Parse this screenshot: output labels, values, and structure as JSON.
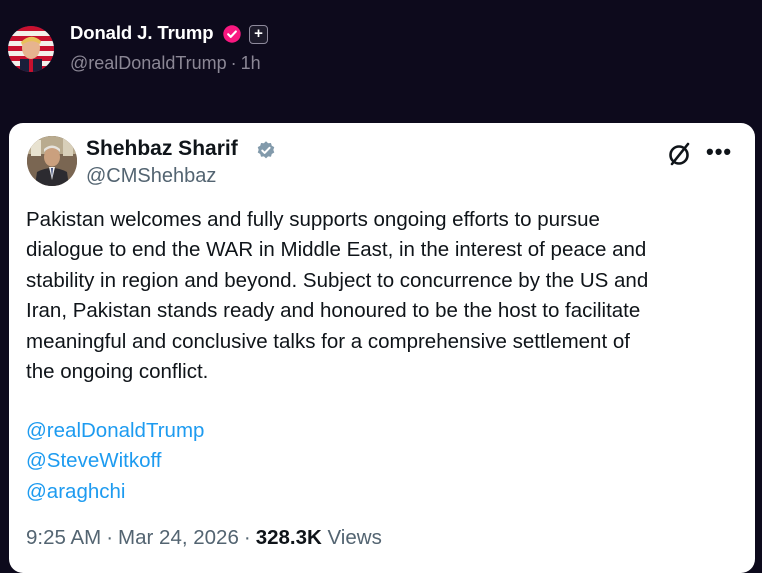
{
  "post": {
    "author": {
      "display_name": "Donald J. Trump",
      "handle": "@realDonaldTrump",
      "separator": "·",
      "time_ago": "1h",
      "verified_icon": "verified-badge-icon",
      "verified_color": "#f91880",
      "extra_badge_icon": "plus-icon",
      "extra_badge_symbol": "+"
    }
  },
  "quoted_tweet": {
    "author": {
      "display_name": "Shehbaz Sharif",
      "handle": "@CMShehbaz",
      "verified_icon": "verified-badge-icon",
      "verified_color": "#829aab"
    },
    "actions": {
      "grok_icon": "grok-icon",
      "more_icon": "more-options-icon",
      "more_symbol": "•••"
    },
    "text_lines": [
      "Pakistan welcomes and fully supports ongoing efforts to pursue",
      "dialogue to end the WAR in Middle East, in the interest of peace and",
      "stability in region and beyond. Subject to concurrence by the US and",
      "Iran, Pakistan stands ready and honoured to be the host to facilitate",
      "meaningful and conclusive talks for a comprehensive settlement of",
      "the ongoing conflict."
    ],
    "mentions": [
      "@realDonaldTrump",
      "@SteveWitkoff",
      "@araghchi"
    ],
    "meta": {
      "time": "9:25 AM",
      "separator": "·",
      "date": "Mar 24, 2026",
      "views_count": "328.3K",
      "views_label": "Views"
    }
  },
  "colors": {
    "page_background": "#0d0a1c",
    "card_background": "#ffffff",
    "link": "#1d9bf0",
    "secondary_text": "#536471",
    "primary_text": "#0f1419"
  }
}
